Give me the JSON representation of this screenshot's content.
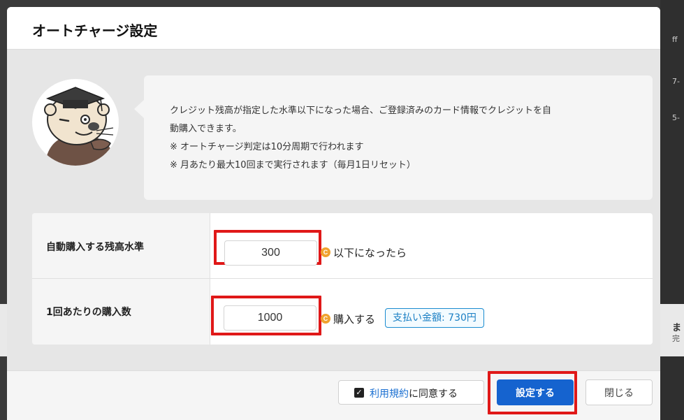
{
  "modal": {
    "title": "オートチャージ設定"
  },
  "info": {
    "line1": "クレジット残高が指定した水準以下になった場合、ご登録済みのカード情報でクレジットを自",
    "line2": "動購入できます。",
    "note1": "※ オートチャージ判定は10分周期で行われます",
    "note2": "※ 月あたり最大10回まで実行されます（毎月1日リセット）"
  },
  "form": {
    "threshold": {
      "label": "自動購入する残高水準",
      "value": "300",
      "suffix": "以下になったら"
    },
    "amount": {
      "label": "1回あたりの購入数",
      "value": "1000",
      "suffix": "購入する",
      "price_badge": "支払い金額: 730円"
    },
    "credit_icon_glyph": "C"
  },
  "footer": {
    "terms_link": "利用規約",
    "terms_suffix": "に同意する",
    "terms_checked": true,
    "save_label": "設定する",
    "close_label": "閉じる"
  },
  "background_fragments": [
    "ff",
    "7-",
    "5-",
    "ま",
    "完"
  ],
  "colors": {
    "primary": "#1563cf",
    "highlight": "#e01818",
    "coin": "#f0a22e",
    "badge": "#1a8bd0"
  }
}
